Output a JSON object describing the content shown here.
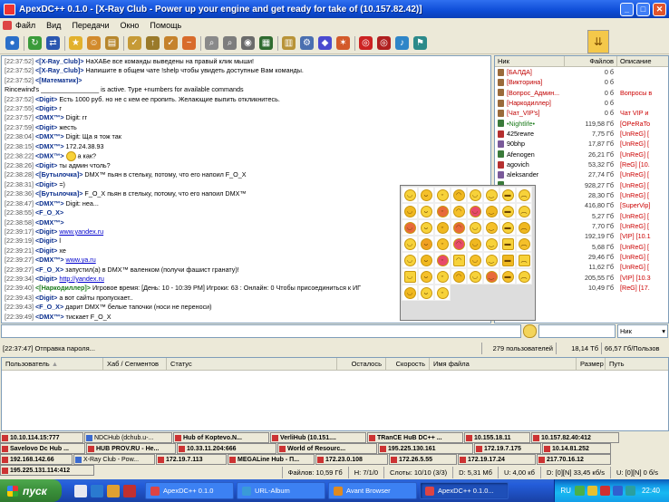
{
  "window": {
    "title": "ApexDC++ 0.1.0 - [X-Ray Club - Power up your engine and get ready for take of (10.157.82.42)]"
  },
  "menu": [
    "Файл",
    "Вид",
    "Передачи",
    "Окно",
    "Помощь"
  ],
  "toolbar_icons": [
    "connect-icon",
    "refresh-icon",
    "reconnect-icon",
    "favorites-icon",
    "favorite-users-icon",
    "queue-icon",
    "finished-icon",
    "upload-queue-icon",
    "finished-uploads-icon",
    "search-icon",
    "adl-search-icon",
    "search-spy-icon",
    "notepad-icon",
    "open-filelist-icon",
    "settings-icon",
    "network-stats-icon",
    "away-icon",
    "limiter-icon",
    "shutdown-icon",
    "refresh-share-icon",
    "winamp-icon"
  ],
  "chat": [
    {
      "ts": "[22:37:52]",
      "nick": "<[X-Ray_Club]>",
      "text": " НаХАБе все команды выведены на правый клик мыши!",
      "nc": "nkb"
    },
    {
      "ts": "[22:37:52]",
      "nick": "<[X-Ray_Club]>",
      "text": " Напишите в общем чате !shelp чтобы увидеть доступные Вам команды.",
      "nc": "nkb"
    },
    {
      "ts": "[22:37:52]",
      "nick": "<[Математик]>",
      "text": "",
      "nc": "nkb"
    },
    {
      "ts": "",
      "nick": "",
      "text": "",
      "nc": ""
    },
    {
      "ts": "",
      "nick": "",
      "text": "                         Rincewind's ________________ is active. Type +numbers for available commands",
      "nc": ""
    },
    {
      "ts": "",
      "nick": "",
      "text": "",
      "nc": ""
    },
    {
      "ts": "[22:37:52]",
      "nick": "<Digit>",
      "text": " Есть 1000 руб. но не с кем ее пропить. Желающие выпить откликнитесь.",
      "nc": "nkb"
    },
    {
      "ts": "[22:37:55]",
      "nick": "<Digit>",
      "text": " г",
      "nc": "nkb"
    },
    {
      "ts": "[22:37:57]",
      "nick": "<DMX™>",
      "text": " Digit: гг",
      "nc": "nkb"
    },
    {
      "ts": "[22:37:59]",
      "nick": "<Digit>",
      "text": " жесть",
      "nc": "nkb"
    },
    {
      "ts": "[22:38:04]",
      "nick": "<DMX™>",
      "text": " Digit: Ща я тож так",
      "nc": "nkb"
    },
    {
      "ts": "[22:38:15]",
      "nick": "<DMX™>",
      "text": " 172.24.38.93",
      "nc": "nkb"
    },
    {
      "ts": "",
      "nick": "",
      "text": "",
      "nc": ""
    },
    {
      "ts": "[22:38:22]",
      "nick": "<DMX™>",
      "text": "  а как?",
      "nc": "nkb"
    },
    {
      "ts": "[22:38:26]",
      "nick": "<Digit>",
      "text": " ты админ чтоль?",
      "nc": "nkb"
    },
    {
      "ts": "[22:38:28]",
      "nick": "<[Бутылочка]>",
      "text": " DMX™ пьян в стельку, потому, что его напоил F_O_X",
      "nc": "nkb"
    },
    {
      "ts": "[22:38:31]",
      "nick": "<Digit>",
      "text": " =)",
      "nc": "nkb"
    },
    {
      "ts": "[22:38:36]",
      "nick": "<[Бутылочка]>",
      "text": " F_O_X пьян в стельку, потому, что его напоил DMX™",
      "nc": "nkb"
    },
    {
      "ts": "[22:38:47]",
      "nick": "<DMX™>",
      "text": " Digit: неа...",
      "nc": "nkb"
    },
    {
      "ts": "[22:38:55]",
      "nick": "<F_O_X>",
      "text": "",
      "nc": "nkb"
    },
    {
      "ts": "[22:38:58]",
      "nick": "<DMX™>",
      "text": "",
      "nc": "nkb"
    },
    {
      "ts": "[22:39:17]",
      "nick": "<Digit>",
      "text": " www.yandex.ru",
      "nc": "nkb",
      "link": true
    },
    {
      "ts": "[22:39:19]",
      "nick": "<Digit>",
      "text": " l",
      "nc": "nkb"
    },
    {
      "ts": "[22:39:21]",
      "nick": "<Digit>",
      "text": " хе",
      "nc": "nkb"
    },
    {
      "ts": "[22:39:27]",
      "nick": "<DMX™>",
      "text": " www.ya.ru",
      "nc": "nkb",
      "link": true
    },
    {
      "ts": "[22:39:27]",
      "nick": "<F_O_X>",
      "text": " запустил(а) в DMX™ валенком (получи фашист гранату)!",
      "nc": "nkb"
    },
    {
      "ts": "[22:39:34]",
      "nick": "<Digit>",
      "text": " http://yandex.ru",
      "nc": "nkb",
      "link": true
    },
    {
      "ts": "[22:39:40]",
      "nick": "<[Наркодиллер]>",
      "text": " Игровое время: [День: 10 - 10:39 PM]  Игроки: 63 : Онлайн: 0 Чтобы присоединиться к ИГ",
      "nc": "nk"
    },
    {
      "ts": "[22:39:43]",
      "nick": "<Digit>",
      "text": " а вот сайты пропускает..",
      "nc": "nkb"
    },
    {
      "ts": "[22:39:43]",
      "nick": "<F_O_X>",
      "text": " дарит DMX™ белые тапочки (носи не переноси)",
      "nc": "nkb"
    },
    {
      "ts": "[22:39:49]",
      "nick": "<DMX™>",
      "text": " тискает F_O_X",
      "nc": "nkb"
    }
  ],
  "userlist": {
    "headers": [
      "Ник",
      "Файлов",
      "Описание"
    ],
    "users": [
      {
        "nick": "[БАЛДА]",
        "files": "0 б",
        "desc": "",
        "nc": "#c00000"
      },
      {
        "nick": "[Викторина]",
        "files": "0 б",
        "desc": "",
        "nc": "#c00000"
      },
      {
        "nick": "[Вопрос_Админ...",
        "files": "0 б",
        "desc": "Вопросы в",
        "nc": "#c00000"
      },
      {
        "nick": "[Наркодиллер]",
        "files": "0 б",
        "desc": "",
        "nc": "#c00000"
      },
      {
        "nick": "[Чат_VIP's]",
        "files": "0 б",
        "desc": "Чат VIP и",
        "nc": "#c00000"
      },
      {
        "nick": "•Nightlife•",
        "files": "119,58 Гб",
        "desc": "[OPeRaTo",
        "nc": "#1a7a1a"
      },
      {
        "nick": "425rewre",
        "files": "7,75 Гб",
        "desc": "[UnReG] [",
        "nc": "#000"
      },
      {
        "nick": "90bhp",
        "files": "17,87 Гб",
        "desc": "[UnReG] [",
        "nc": "#000"
      },
      {
        "nick": "Afenogen",
        "files": "26,21 Гб",
        "desc": "[UnReG] [",
        "nc": "#000"
      },
      {
        "nick": "agovich",
        "files": "53,32 Гб",
        "desc": "[ReG] [10.",
        "nc": "#000"
      },
      {
        "nick": "aleksander",
        "files": "27,74 Гб",
        "desc": "[UnReG] [",
        "nc": "#000"
      },
      {
        "nick": "",
        "files": "928,27 Гб",
        "desc": "[UnReG] [",
        "nc": "#000"
      },
      {
        "nick": "",
        "files": "28,30 Гб",
        "desc": "[UnReG] [",
        "nc": "#000"
      },
      {
        "nick": "",
        "files": "416,80 Гб",
        "desc": "[SuperVip]",
        "nc": "#000"
      },
      {
        "nick": "",
        "files": "5,27 Гб",
        "desc": "[UnReG] [",
        "nc": "#000"
      },
      {
        "nick": "",
        "files": "7,70 Гб",
        "desc": "[UnReG] [",
        "nc": "#000"
      },
      {
        "nick": "",
        "files": "192,19 Гб",
        "desc": "[VIP] [10.1",
        "nc": "#000"
      },
      {
        "nick": "",
        "files": "5,68 Гб",
        "desc": "[UnReG] [",
        "nc": "#000"
      },
      {
        "nick": "",
        "files": "29,46 Гб",
        "desc": "[UnReG] [",
        "nc": "#000"
      },
      {
        "nick": "",
        "files": "11,62 Гб",
        "desc": "[UnReG] [",
        "nc": "#000"
      },
      {
        "nick": "",
        "files": "205,55 Гб",
        "desc": "[VIP] [10.3",
        "nc": "#000"
      },
      {
        "nick": "hooligan",
        "files": "10,49 Гб",
        "desc": "[ReG] [17.",
        "nc": "#000"
      }
    ]
  },
  "emoticons": [
    "smile",
    "grin",
    "tongue",
    "laugh",
    "happy",
    "wink",
    "cool",
    "sad",
    "idea",
    "shy",
    "devil",
    "kiss",
    "love",
    "surprise",
    "nerd",
    "cry",
    "angry",
    "shock",
    "roll",
    "evil",
    "dizzy",
    "sleepy",
    "smirk",
    "blush",
    "confused",
    "warning",
    "angel",
    "heart",
    "yawn",
    "clap",
    "drink",
    "hug",
    "whistle",
    "sick",
    "rose",
    "beer",
    "party",
    "ok",
    "cake",
    "phone",
    "thumb",
    "sorry",
    "evil-grin",
    "doh",
    "drool",
    "rage",
    "skull",
    "ninja",
    "beat",
    "cool2",
    "smile2",
    "",
    "",
    "",
    "",
    ""
  ],
  "input": {
    "message": "",
    "filter": "",
    "filter_column": "Ник"
  },
  "status": {
    "last": "[22:37:47] Отправка пароля...",
    "users": "279 пользователей",
    "share": "18,14 Тб",
    "avg": "66,57 Гб/Пользов"
  },
  "transfers": {
    "headers": [
      "Пользователь",
      "Хаб / Сегментов",
      "Статус",
      "Осталось",
      "Скорость",
      "Имя файла",
      "Размер",
      "Путь"
    ]
  },
  "hubs": [
    {
      "label": "10.10.114.15:777",
      "b": true
    },
    {
      "label": "NDCHub (dchub.u-...",
      "b": false
    },
    {
      "label": "Hub of Koptevo.N...",
      "b": true
    },
    {
      "label": "VerliHub (10.151....",
      "b": true
    },
    {
      "label": "TRanCE HuB DC++ ...",
      "b": true
    },
    {
      "label": "10.155.18.11",
      "b": true
    },
    {
      "label": "10.157.82.40:412",
      "b": true
    },
    {
      "label": "Savelovo Dc Hub ...",
      "b": true
    },
    {
      "label": "HUB PROV.RU - He...",
      "b": true
    },
    {
      "label": "10.33.11.204:666",
      "b": true
    },
    {
      "label": "World of Resourc...",
      "b": true
    },
    {
      "label": "195.225.130.161",
      "b": true
    },
    {
      "label": "172.19.7.175",
      "b": true
    },
    {
      "label": "10.14.81.252",
      "b": true
    },
    {
      "label": "192.168.142.66",
      "b": true
    },
    {
      "label": "X-Ray Club - Pow...",
      "b": false
    },
    {
      "label": "172.19.7.113",
      "b": true
    },
    {
      "label": "MEGALine Hub - П...",
      "b": true
    },
    {
      "label": "172.23.0.108",
      "b": true
    },
    {
      "label": "172.26.5.55",
      "b": true
    },
    {
      "label": "172.19.17.24",
      "b": true
    },
    {
      "label": "217.70.16.12",
      "b": true
    },
    {
      "label": "195.225.131.114:412",
      "b": true
    }
  ],
  "hubstatus": {
    "files": "Файлов: 10,59 Гб",
    "hubs": "Н: 7/1/0",
    "slots": "Слоты: 10/10 (3/3)",
    "down": "D: 5,31 Мб",
    "up": "U: 4,00 кб",
    "dl": "D: [0][N] 33,45 кб/s",
    "ul": "U: [0][N] 0 б/s"
  },
  "taskbar": {
    "start": "пуск",
    "tasks": [
      "ApexDC++ 0.1.0",
      "URL-Album",
      "Avant Browser",
      "ApexDC++ 0.1.0..."
    ],
    "lang": "RU",
    "clock": "22:40"
  },
  "colors": {
    "titlebar": "#0d4cd6",
    "taskbar": "#245edb",
    "start": "#3a8f3a",
    "link": "#0000cc",
    "nick": "#0b2f8e",
    "op": "#c00000"
  }
}
